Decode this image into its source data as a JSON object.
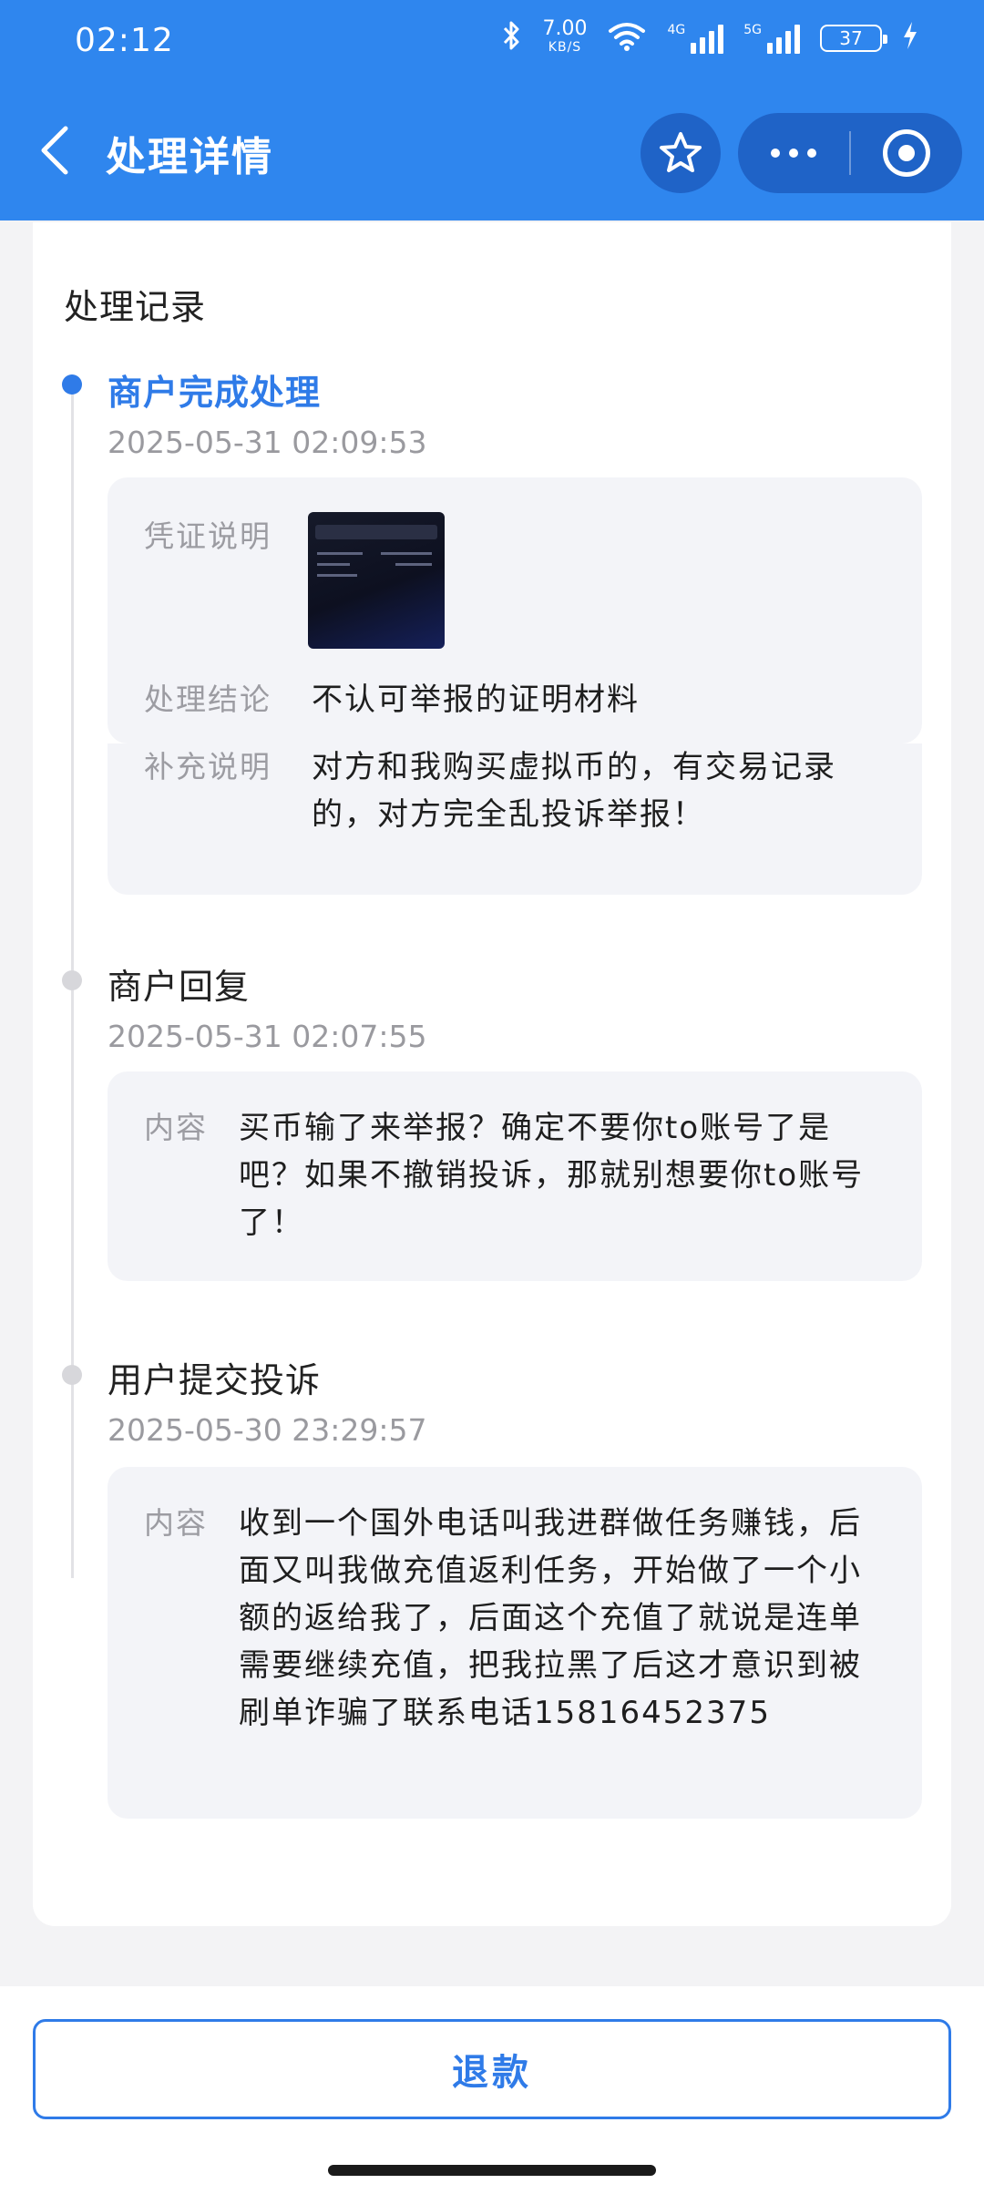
{
  "status_bar": {
    "time": "02:12",
    "net_speed_value": "7.00",
    "net_speed_unit": "KB/S",
    "signal_1_label": "4G",
    "signal_2_label": "5G",
    "battery": "37"
  },
  "nav": {
    "title": "处理详情"
  },
  "record": {
    "section_title": "处理记录",
    "entries": [
      {
        "title": "商户完成处理",
        "time": "2025-05-31 02:09:53",
        "voucher_label": "凭证说明",
        "conclusion_label": "处理结论",
        "conclusion_value": "不认可举报的证明材料",
        "note_label": "补充说明",
        "note_value": "对方和我购买虚拟币的，有交易记录的，对方完全乱投诉举报！"
      },
      {
        "title": "商户回复",
        "time": "2025-05-31 02:07:55",
        "content_label": "内容",
        "content_value": "买币输了来举报？确定不要你to账号了是吧？如果不撤销投诉，那就别想要你to账号了！"
      },
      {
        "title": "用户提交投诉",
        "time": "2025-05-30 23:29:57",
        "content_label": "内容",
        "content_value": "收到一个国外电话叫我进群做任务赚钱，后面又叫我做充值返利任务，开始做了一个小额的返给我了，后面这个充值了就说是连单需要继续充值，把我拉黑了后这才意识到被刷单诈骗了联系电话15816452375"
      }
    ]
  },
  "footer": {
    "refund_label": "退款"
  }
}
